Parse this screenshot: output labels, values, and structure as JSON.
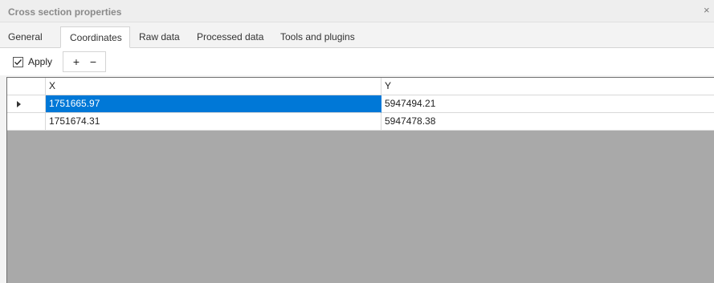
{
  "window": {
    "title": "Cross section properties",
    "close_glyph": "×"
  },
  "tabs": [
    {
      "label": "General",
      "active": false
    },
    {
      "label": "Coordinates",
      "active": true
    },
    {
      "label": "Raw data",
      "active": false
    },
    {
      "label": "Processed data",
      "active": false
    },
    {
      "label": "Tools and plugins",
      "active": false
    }
  ],
  "toolbar": {
    "apply_label": "Apply",
    "apply_checked": true,
    "add_label": "+",
    "remove_label": "−"
  },
  "grid": {
    "columns": [
      "X",
      "Y"
    ],
    "rows": [
      {
        "x": "1751665.97",
        "y": "5947494.21",
        "current": true,
        "x_selected": true
      },
      {
        "x": "1751674.31",
        "y": "5947478.38",
        "current": false,
        "x_selected": false
      }
    ]
  },
  "colors": {
    "selection": "#0078d7",
    "empty_grid": "#a9a9a9"
  },
  "icons": {
    "row_indicator": "triangle-right-icon",
    "checkbox_check": "checkmark-icon",
    "close": "close-icon"
  }
}
